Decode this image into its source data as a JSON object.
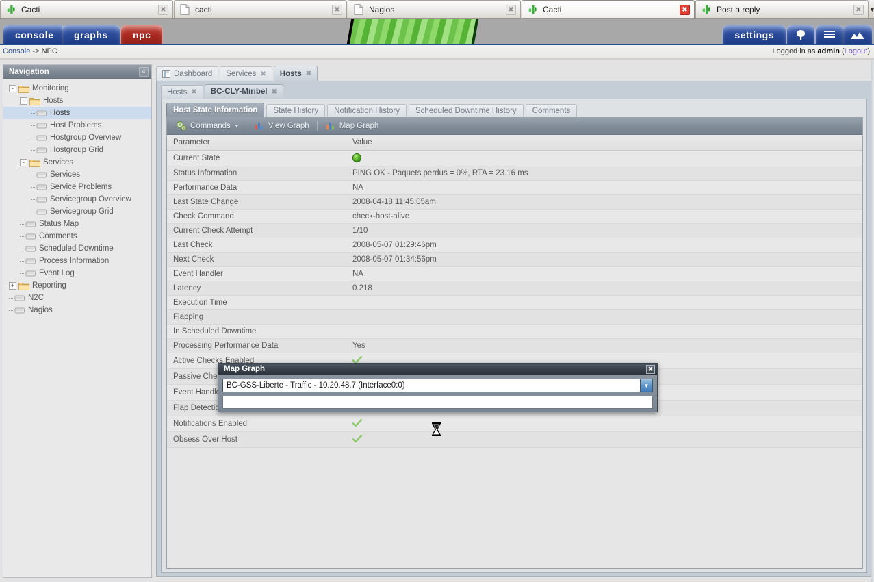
{
  "browser": {
    "tabs": [
      {
        "label": "Cacti",
        "icon": "cactus-icon",
        "active": false,
        "close": "close-icon"
      },
      {
        "label": "cacti",
        "icon": "document-icon",
        "active": false,
        "close": "close-icon"
      },
      {
        "label": "Nagios",
        "icon": "document-icon",
        "active": false,
        "close": "close-icon"
      },
      {
        "label": "Cacti",
        "icon": "cactus-icon",
        "active": true,
        "close": "close-icon"
      },
      {
        "label": "Post a reply",
        "icon": "cactus-icon",
        "active": false,
        "close": "close-icon"
      }
    ],
    "scroll_arrow": "▼"
  },
  "topnav": {
    "tabs": [
      {
        "label": "console",
        "color": "#2c4c9b",
        "icon": null
      },
      {
        "label": "graphs",
        "color": "#2c4c9b",
        "icon": null
      },
      {
        "label": "npc",
        "color": "#ad2b22",
        "icon": null
      }
    ],
    "right_tabs": [
      {
        "label": "settings",
        "color": "#2c4c9b",
        "icon": null
      },
      {
        "label": "",
        "color": "#2c4c9b",
        "icon": "tree-icon"
      },
      {
        "label": "",
        "color": "#2c4c9b",
        "icon": "list-icon"
      },
      {
        "label": "",
        "color": "#2c4c9b",
        "icon": "mountains-icon"
      }
    ]
  },
  "breadcrumb": {
    "root": "Console",
    "separator": " -> ",
    "current": "NPC",
    "logged_in_prefix": "Logged in as ",
    "user": "admin",
    "logout_open": " (",
    "logout": "Logout",
    "logout_close": ")"
  },
  "sidebar": {
    "title": "Navigation",
    "collapse_icon": "«",
    "items": [
      {
        "label": "Monitoring",
        "depth": 0,
        "type": "folder",
        "toggle": "-",
        "selected": false
      },
      {
        "label": "Hosts",
        "depth": 1,
        "type": "folder",
        "toggle": "-",
        "selected": false
      },
      {
        "label": "Hosts",
        "depth": 2,
        "type": "leaf",
        "toggle": "",
        "selected": true
      },
      {
        "label": "Host Problems",
        "depth": 2,
        "type": "leaf",
        "toggle": "",
        "selected": false
      },
      {
        "label": "Hostgroup Overview",
        "depth": 2,
        "type": "leaf",
        "toggle": "",
        "selected": false
      },
      {
        "label": "Hostgroup Grid",
        "depth": 2,
        "type": "leaf",
        "toggle": "",
        "selected": false
      },
      {
        "label": "Services",
        "depth": 1,
        "type": "folder",
        "toggle": "-",
        "selected": false
      },
      {
        "label": "Services",
        "depth": 2,
        "type": "leaf",
        "toggle": "",
        "selected": false
      },
      {
        "label": "Service Problems",
        "depth": 2,
        "type": "leaf",
        "toggle": "",
        "selected": false
      },
      {
        "label": "Servicegroup Overview",
        "depth": 2,
        "type": "leaf",
        "toggle": "",
        "selected": false
      },
      {
        "label": "Servicegroup Grid",
        "depth": 2,
        "type": "leaf",
        "toggle": "",
        "selected": false
      },
      {
        "label": "Status Map",
        "depth": 1,
        "type": "leaf",
        "toggle": "",
        "selected": false
      },
      {
        "label": "Comments",
        "depth": 1,
        "type": "leaf",
        "toggle": "",
        "selected": false
      },
      {
        "label": "Scheduled Downtime",
        "depth": 1,
        "type": "leaf",
        "toggle": "",
        "selected": false
      },
      {
        "label": "Process Information",
        "depth": 1,
        "type": "leaf",
        "toggle": "",
        "selected": false
      },
      {
        "label": "Event Log",
        "depth": 1,
        "type": "leaf",
        "toggle": "",
        "selected": false
      },
      {
        "label": "Reporting",
        "depth": 0,
        "type": "folder",
        "toggle": "+",
        "selected": false
      },
      {
        "label": "N2C",
        "depth": 0,
        "type": "leaf",
        "toggle": "",
        "selected": false
      },
      {
        "label": "Nagios",
        "depth": 0,
        "type": "leaf",
        "toggle": "",
        "selected": false
      }
    ]
  },
  "main": {
    "outer_tabs": [
      {
        "label": "Dashboard",
        "active": false,
        "closable": false,
        "icon": "dashboard-icon"
      },
      {
        "label": "Services",
        "active": false,
        "closable": true,
        "icon": null
      },
      {
        "label": "Hosts",
        "active": true,
        "closable": true,
        "icon": null
      }
    ],
    "inner_tabs": [
      {
        "label": "Hosts",
        "active": false,
        "closable": true
      },
      {
        "label": "BC-CLY-Miribel",
        "active": true,
        "closable": true
      }
    ],
    "sub_tabs": [
      {
        "label": "Host State Information",
        "active": true
      },
      {
        "label": "State History",
        "active": false
      },
      {
        "label": "Notification History",
        "active": false
      },
      {
        "label": "Scheduled Downtime History",
        "active": false
      },
      {
        "label": "Comments",
        "active": false
      }
    ],
    "toolbar": {
      "commands_label": "Commands",
      "commands_icon": "gears-icon",
      "commands_caret": "▾",
      "view_graph_label": "View Graph",
      "view_graph_icon": "bar-chart-icon",
      "map_graph_label": "Map Graph",
      "map_graph_icon": "bar-chart-icon"
    },
    "table": {
      "headers": [
        "Parameter",
        "Value"
      ],
      "rows": [
        {
          "parameter": "Current State",
          "value": "",
          "value_type": "green-ball"
        },
        {
          "parameter": "Status Information",
          "value": "PING OK - Paquets perdus = 0%, RTA = 23.16 ms",
          "value_type": "text"
        },
        {
          "parameter": "Performance Data",
          "value": "NA",
          "value_type": "text"
        },
        {
          "parameter": "Last State Change",
          "value": "2008-04-18 11:45:05am",
          "value_type": "text"
        },
        {
          "parameter": "Check Command",
          "value": "check-host-alive",
          "value_type": "text"
        },
        {
          "parameter": "Current Check Attempt",
          "value": "1/10",
          "value_type": "text"
        },
        {
          "parameter": "Last Check",
          "value": "2008-05-07 01:29:46pm",
          "value_type": "text"
        },
        {
          "parameter": "Next Check",
          "value": "2008-05-07 01:34:56pm",
          "value_type": "text"
        },
        {
          "parameter": "Event Handler",
          "value": "NA",
          "value_type": "text"
        },
        {
          "parameter": "Latency",
          "value": "0.218",
          "value_type": "text"
        },
        {
          "parameter": "Execution Time",
          "value": "",
          "value_type": "text"
        },
        {
          "parameter": "Flapping",
          "value": "",
          "value_type": "text"
        },
        {
          "parameter": "In Scheduled Downtime",
          "value": "",
          "value_type": "text"
        },
        {
          "parameter": "Processing Performance Data",
          "value": "Yes",
          "value_type": "text"
        },
        {
          "parameter": "Active Checks Enabled",
          "value": "",
          "value_type": "check"
        },
        {
          "parameter": "Passive Checks Enabled",
          "value": "",
          "value_type": "check"
        },
        {
          "parameter": "Event Handler Enabled",
          "value": "",
          "value_type": "check"
        },
        {
          "parameter": "Flap Detection Enabled",
          "value": "",
          "value_type": "check"
        },
        {
          "parameter": "Notifications Enabled",
          "value": "",
          "value_type": "check"
        },
        {
          "parameter": "Obsess Over Host",
          "value": "",
          "value_type": "check"
        }
      ]
    }
  },
  "dialog": {
    "title": "Map Graph",
    "close_icon": "close-icon",
    "select_value": "BC-GSS-Liberte - Traffic - 10.20.48.7 (Interface0:0)",
    "select_arrow": "▼",
    "secondary_field_value": ""
  },
  "cursor": {
    "type": "hourglass"
  },
  "colors": {
    "nav_blue": "#2c4c9b",
    "nav_red": "#ad2b22",
    "banner_green": "#6cc24a",
    "link": "#2b4a94",
    "logout_link": "#6b4fae",
    "panel_bg": "#c5ced6",
    "table_bg": "#e8e8e8",
    "status_ok": "#66c031"
  }
}
